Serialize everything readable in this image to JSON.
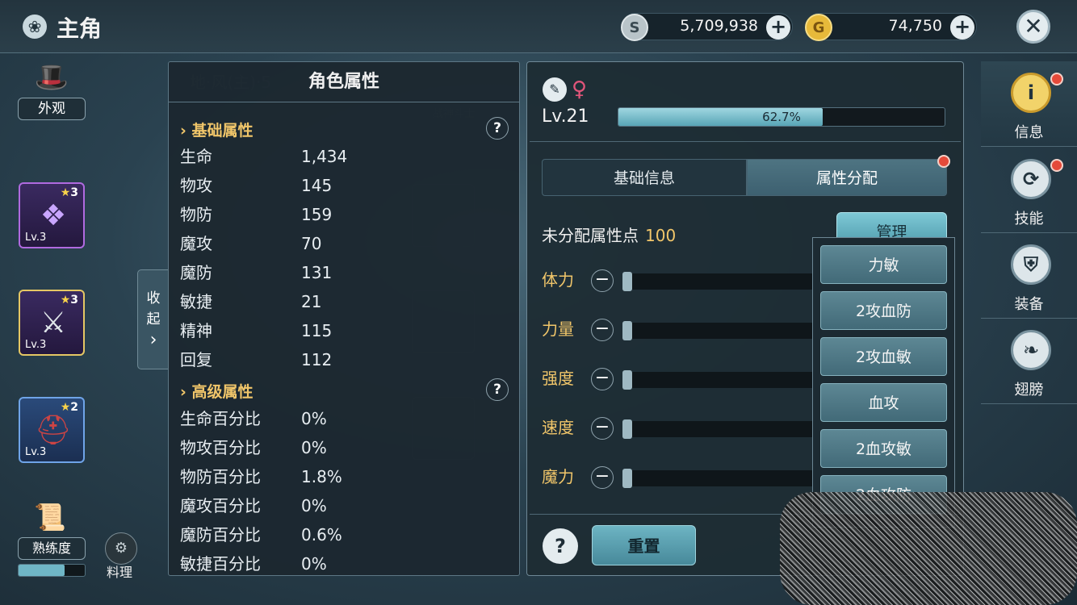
{
  "header": {
    "title": "主角",
    "silver": "5,709,938",
    "gold": "74,750",
    "plus": "+",
    "close": "✕"
  },
  "left": {
    "appearance_label": "外观",
    "slots": [
      {
        "stars": "3",
        "lv": "Lv.3"
      },
      {
        "stars": "3",
        "lv": "Lv.3"
      },
      {
        "stars": "2",
        "lv": "Lv.3"
      }
    ],
    "proficiency_label": "熟练度",
    "proficiency_level": 0.7,
    "cooking_label": "料理",
    "collapse_label_1": "收",
    "collapse_label_2": "起",
    "collapse_arrow": "›"
  },
  "stats_panel": {
    "title": "角色属性",
    "basic_title": "基础属性",
    "advanced_title": "高级属性",
    "help": "?",
    "basic": [
      {
        "k": "生命",
        "v": "1,434"
      },
      {
        "k": "物攻",
        "v": "145"
      },
      {
        "k": "物防",
        "v": "159"
      },
      {
        "k": "魔攻",
        "v": "70"
      },
      {
        "k": "魔防",
        "v": "131"
      },
      {
        "k": "敏捷",
        "v": "21"
      },
      {
        "k": "精神",
        "v": "115"
      },
      {
        "k": "回复",
        "v": "112"
      }
    ],
    "advanced": [
      {
        "k": "生命百分比",
        "v": "0%"
      },
      {
        "k": "物攻百分比",
        "v": "0%"
      },
      {
        "k": "物防百分比",
        "v": "1.8%"
      },
      {
        "k": "魔攻百分比",
        "v": "0%"
      },
      {
        "k": "魔防百分比",
        "v": "0.6%"
      },
      {
        "k": "敏捷百分比",
        "v": "0%"
      }
    ]
  },
  "main_panel": {
    "level": "Lv.21",
    "xp_text": "62.7%",
    "xp_fraction": 0.627,
    "tab_basic": "基础信息",
    "tab_attr": "属性分配",
    "unallocated_label": "未分配属性点",
    "unallocated_value": "100",
    "manage": "管理",
    "minus": "−",
    "attributes": [
      "体力",
      "力量",
      "强度",
      "速度",
      "魔力"
    ],
    "dropdown": [
      "力敏",
      "2攻血防",
      "2攻血敏",
      "血攻",
      "2血攻敏",
      "2血攻防"
    ],
    "help": "?",
    "reset": "重置"
  },
  "right_tabs": [
    {
      "label": "信息",
      "icon": "i"
    },
    {
      "label": "技能",
      "icon": "⟳"
    },
    {
      "label": "装备",
      "icon": "⛨"
    },
    {
      "label": "翅膀",
      "icon": "❧"
    }
  ]
}
